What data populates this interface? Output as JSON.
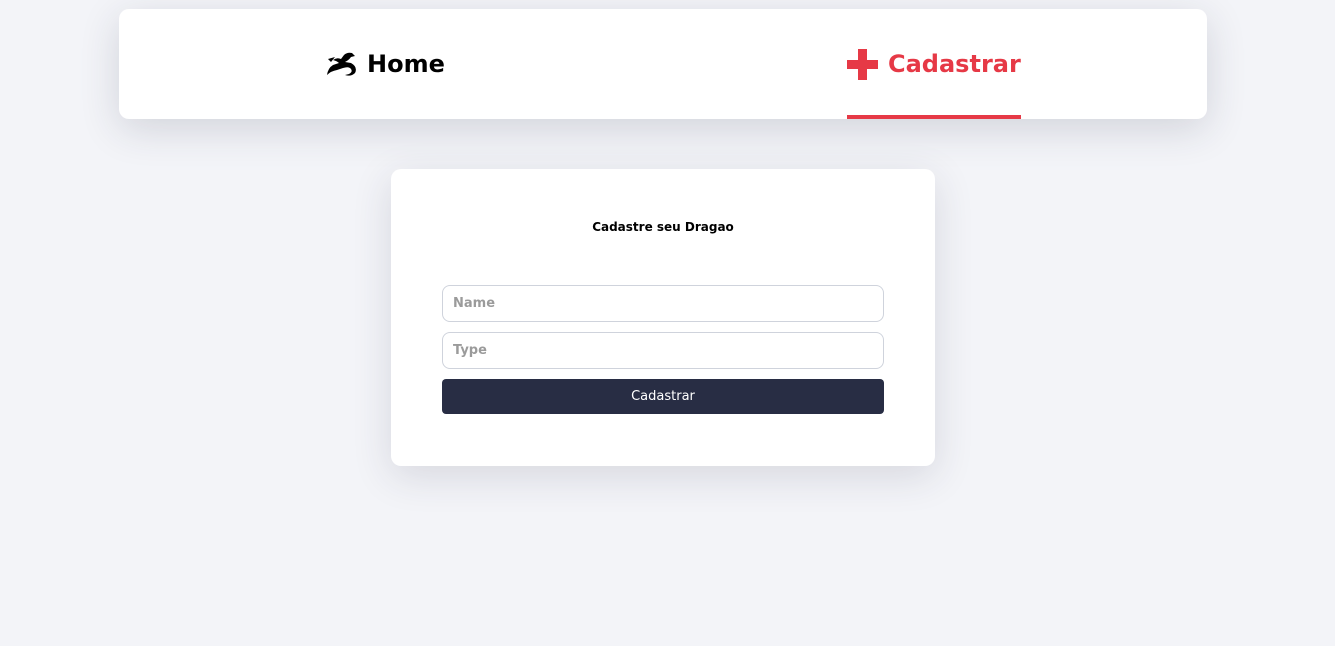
{
  "nav": {
    "home": {
      "label": "Home",
      "icon": "dragon-icon"
    },
    "register": {
      "label": "Cadastrar",
      "icon": "plus-icon",
      "active": true,
      "color": "#e63946"
    }
  },
  "form": {
    "title": "Cadastre seu Dragao",
    "name": {
      "placeholder": "Name",
      "value": ""
    },
    "type": {
      "placeholder": "Type",
      "value": ""
    },
    "submit_label": "Cadastrar"
  },
  "colors": {
    "background": "#f3f4f8",
    "accent": "#e63946",
    "button": "#282d44"
  }
}
